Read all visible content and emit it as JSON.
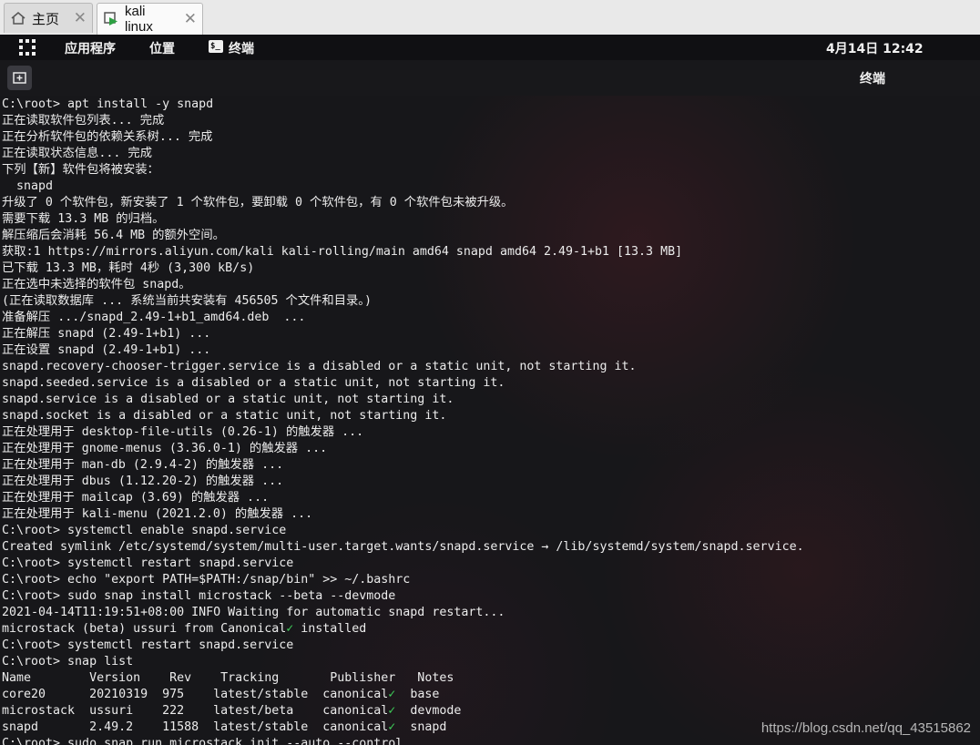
{
  "vm_tabs": [
    {
      "label": "主页",
      "icon": "home-icon",
      "active": false
    },
    {
      "label": "kali linux",
      "icon": "vm-icon",
      "active": true
    }
  ],
  "top_bar": {
    "applications": "应用程序",
    "places": "位置",
    "terminal_app": "终端",
    "clock": "4月14日 12:42"
  },
  "terminal": {
    "title": "终端",
    "check_color": "#3fd15a",
    "lines": [
      "C:\\root> apt install -y snapd",
      "正在读取软件包列表... 完成",
      "正在分析软件包的依赖关系树... 完成",
      "正在读取状态信息... 完成",
      "下列【新】软件包将被安装：",
      "  snapd",
      "升级了 0 个软件包，新安装了 1 个软件包，要卸载 0 个软件包，有 0 个软件包未被升级。",
      "需要下载 13.3 MB 的归档。",
      "解压缩后会消耗 56.4 MB 的额外空间。",
      "获取:1 https://mirrors.aliyun.com/kali kali-rolling/main amd64 snapd amd64 2.49-1+b1 [13.3 MB]",
      "已下载 13.3 MB，耗时 4秒 (3,300 kB/s)",
      "正在选中未选择的软件包 snapd。",
      "(正在读取数据库 ... 系统当前共安装有 456505 个文件和目录。)",
      "准备解压 .../snapd_2.49-1+b1_amd64.deb  ...",
      "正在解压 snapd (2.49-1+b1) ...",
      "正在设置 snapd (2.49-1+b1) ...",
      "snapd.recovery-chooser-trigger.service is a disabled or a static unit, not starting it.",
      "snapd.seeded.service is a disabled or a static unit, not starting it.",
      "snapd.service is a disabled or a static unit, not starting it.",
      "snapd.socket is a disabled or a static unit, not starting it.",
      "正在处理用于 desktop-file-utils (0.26-1) 的触发器 ...",
      "正在处理用于 gnome-menus (3.36.0-1) 的触发器 ...",
      "正在处理用于 man-db (2.9.4-2) 的触发器 ...",
      "正在处理用于 dbus (1.12.20-2) 的触发器 ...",
      "正在处理用于 mailcap (3.69) 的触发器 ...",
      "正在处理用于 kali-menu (2021.2.0) 的触发器 ...",
      "C:\\root> systemctl enable snapd.service",
      "Created symlink /etc/systemd/system/multi-user.target.wants/snapd.service → /lib/systemd/system/snapd.service.",
      "C:\\root> systemctl restart snapd.service",
      "C:\\root> echo \"export PATH=$PATH:/snap/bin\" >> ~/.bashrc",
      "C:\\root> sudo snap install microstack --beta --devmode",
      "2021-04-14T11:19:51+08:00 INFO Waiting for automatic snapd restart...",
      "microstack (beta) ussuri from Canonical✓ installed",
      "C:\\root> systemctl restart snapd.service",
      "C:\\root> snap list",
      "Name        Version    Rev    Tracking       Publisher   Notes",
      "core20      20210319  975    latest/stable  canonical✓  base",
      "microstack  ussuri    222    latest/beta    canonical✓  devmode",
      "snapd       2.49.2    11588  latest/stable  canonical✓  snapd",
      "C:\\root> sudo snap run microstack.init --auto --control"
    ]
  },
  "watermark": "https://blog.csdn.net/qq_43515862"
}
